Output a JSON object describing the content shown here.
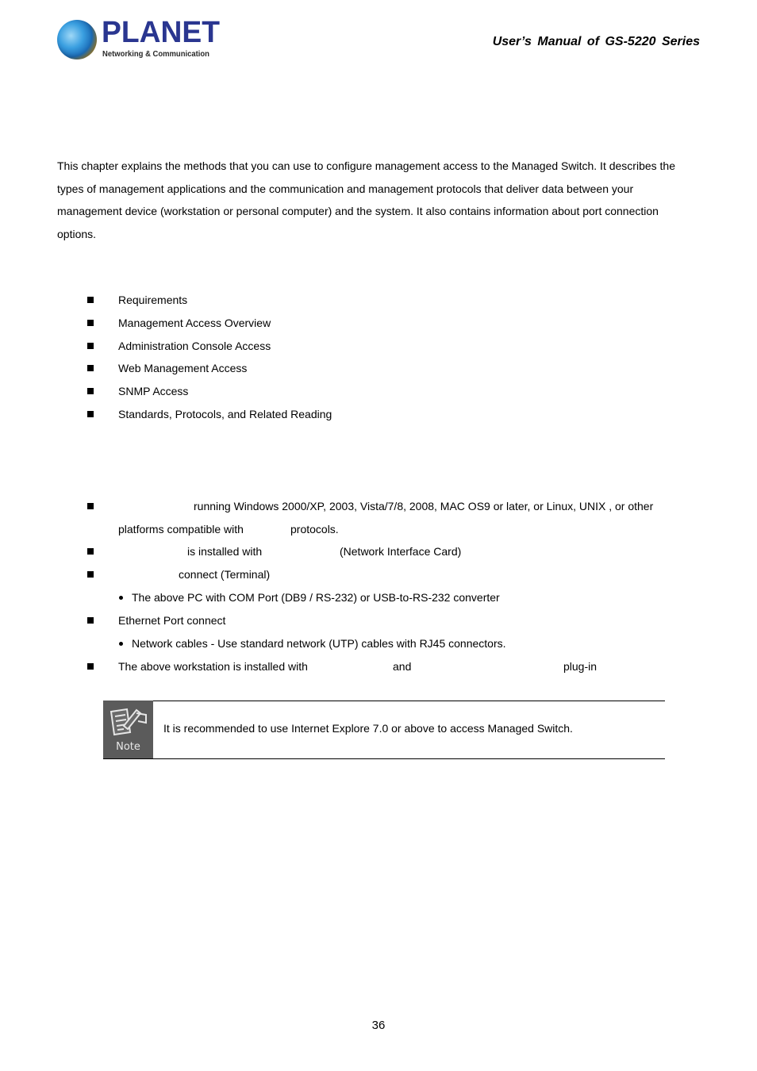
{
  "header": {
    "logo": {
      "brand": "PLANET",
      "tagline": "Networking & Communication"
    },
    "title": "User’s  Manual  of  GS-5220  Series"
  },
  "intro": {
    "lines": [
      "This chapter explains the methods that you can use to configure management access to the Managed Switch. It describes the",
      "types of management applications and the communication and management protocols that deliver data between your",
      "management device (workstation or personal computer) and the system. It also contains information about port connection",
      "options."
    ]
  },
  "topics": [
    "Requirements",
    "Management Access Overview",
    "Administration Console Access",
    "Web Management Access",
    "SNMP Access",
    "Standards, Protocols, and Related Reading"
  ],
  "requirements": {
    "item1_line1": "running Windows 2000/XP, 2003, Vista/7/8, 2008, MAC OS9 or later, or Linux, UNIX , or other",
    "item1_line2a": "platforms compatible with",
    "item1_line2b": "protocols.",
    "item2a": "is installed with",
    "item2b": "(Network Interface Card)",
    "item3": "connect (Terminal)",
    "item3_sub": "The above PC with COM Port (DB9 / RS-232) or USB-to-RS-232 converter",
    "item4": "Ethernet Port connect",
    "item4_sub": "Network cables - Use standard network (UTP) cables with RJ45 connectors.",
    "item5a": "The above workstation is installed with",
    "item5b": "and",
    "item5c": "plug-in"
  },
  "note": {
    "icon": "note-pencil-icon",
    "label": "Note",
    "text": "It is recommended to use Internet Explore 7.0 or above to access Managed Switch."
  },
  "footer": {
    "page_number": "36"
  }
}
